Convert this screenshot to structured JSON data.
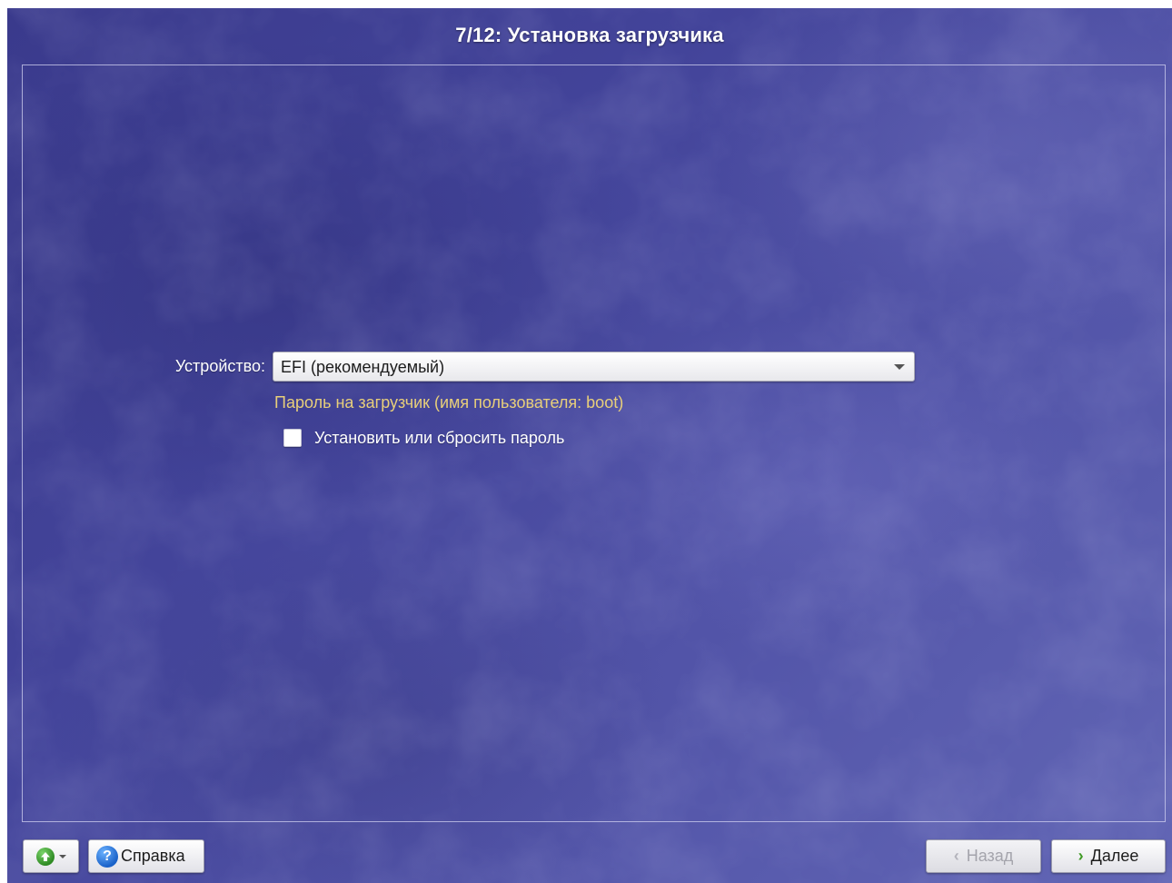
{
  "window": {
    "title": "7/12: Установка загрузчика"
  },
  "form": {
    "device_label": "Устройство:",
    "device_value": "EFI (рекомендуемый)",
    "password_hint": "Пароль на загрузчик (имя пользователя: boot)",
    "set_password_label": "Установить или сбросить пароль",
    "set_password_checked": false
  },
  "footer": {
    "menu_icon": "green-up-arrow-icon",
    "help_icon": "question-mark-icon",
    "help_label": "Справка",
    "back_label": "Назад",
    "back_enabled": false,
    "next_label": "Далее"
  },
  "colors": {
    "background": "#43449a",
    "hint_text": "#e8cf7a",
    "next_arrow": "#3f9a24"
  }
}
